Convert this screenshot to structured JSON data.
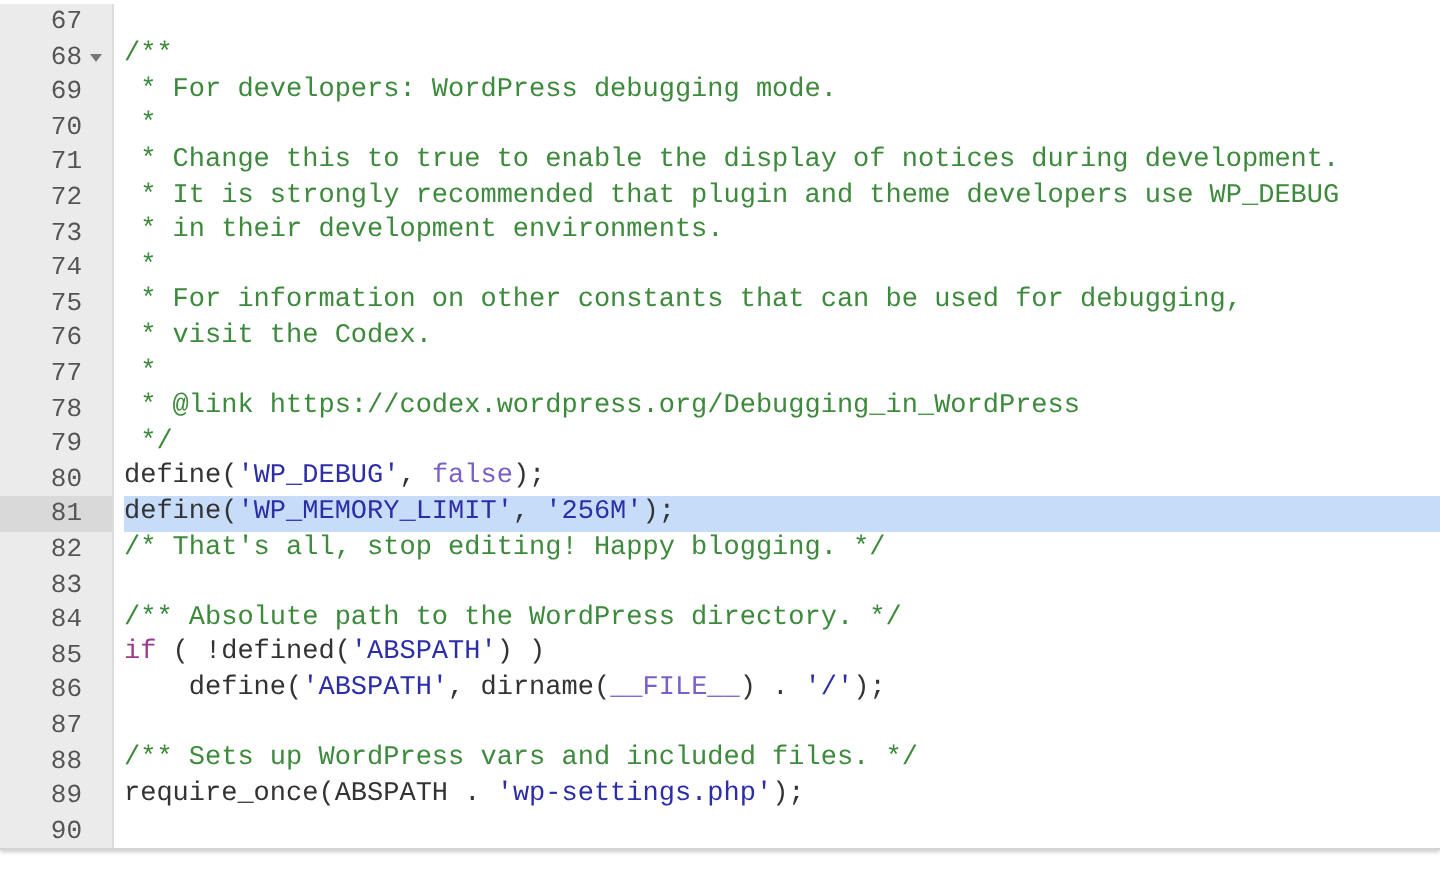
{
  "lines": [
    {
      "number": "67",
      "fold": false,
      "selected": false
    },
    {
      "number": "68",
      "fold": true,
      "selected": false,
      "tokens": [
        {
          "kind": "comment",
          "text": "/**"
        }
      ]
    },
    {
      "number": "69",
      "fold": false,
      "selected": false,
      "tokens": [
        {
          "kind": "comment",
          "text": " * For developers: WordPress debugging mode."
        }
      ]
    },
    {
      "number": "70",
      "fold": false,
      "selected": false,
      "tokens": [
        {
          "kind": "comment",
          "text": " *"
        }
      ]
    },
    {
      "number": "71",
      "fold": false,
      "selected": false,
      "tokens": [
        {
          "kind": "comment",
          "text": " * Change this to true to enable the display of notices during development."
        }
      ]
    },
    {
      "number": "72",
      "fold": false,
      "selected": false,
      "tokens": [
        {
          "kind": "comment",
          "text": " * It is strongly recommended that plugin and theme developers use WP_DEBUG"
        }
      ]
    },
    {
      "number": "73",
      "fold": false,
      "selected": false,
      "tokens": [
        {
          "kind": "comment",
          "text": " * in their development environments."
        }
      ]
    },
    {
      "number": "74",
      "fold": false,
      "selected": false,
      "tokens": [
        {
          "kind": "comment",
          "text": " *"
        }
      ]
    },
    {
      "number": "75",
      "fold": false,
      "selected": false,
      "tokens": [
        {
          "kind": "comment",
          "text": " * For information on other constants that can be used for debugging,"
        }
      ]
    },
    {
      "number": "76",
      "fold": false,
      "selected": false,
      "tokens": [
        {
          "kind": "comment",
          "text": " * visit the Codex."
        }
      ]
    },
    {
      "number": "77",
      "fold": false,
      "selected": false,
      "tokens": [
        {
          "kind": "comment",
          "text": " *"
        }
      ]
    },
    {
      "number": "78",
      "fold": false,
      "selected": false,
      "tokens": [
        {
          "kind": "comment",
          "text": " * @link https://codex.wordpress.org/Debugging_in_WordPress"
        }
      ]
    },
    {
      "number": "79",
      "fold": false,
      "selected": false,
      "tokens": [
        {
          "kind": "comment",
          "text": " */"
        }
      ]
    },
    {
      "number": "80",
      "fold": false,
      "selected": false,
      "tokens": [
        {
          "kind": "plain",
          "text": "define("
        },
        {
          "kind": "string",
          "text": "'WP_DEBUG'"
        },
        {
          "kind": "plain",
          "text": ", "
        },
        {
          "kind": "constant",
          "text": "false"
        },
        {
          "kind": "plain",
          "text": ");"
        }
      ]
    },
    {
      "number": "81",
      "fold": false,
      "selected": true,
      "tokens": [
        {
          "kind": "plain",
          "text": "define("
        },
        {
          "kind": "string",
          "text": "'WP_MEMORY_LIMIT'"
        },
        {
          "kind": "plain",
          "text": ", "
        },
        {
          "kind": "string",
          "text": "'256M'"
        },
        {
          "kind": "plain",
          "text": ");"
        }
      ]
    },
    {
      "number": "82",
      "fold": false,
      "selected": false,
      "tokens": [
        {
          "kind": "comment",
          "text": "/* That's all, stop editing! Happy blogging. */"
        }
      ]
    },
    {
      "number": "83",
      "fold": false,
      "selected": false
    },
    {
      "number": "84",
      "fold": false,
      "selected": false,
      "tokens": [
        {
          "kind": "comment",
          "text": "/** Absolute path to the WordPress directory. */"
        }
      ]
    },
    {
      "number": "85",
      "fold": false,
      "selected": false,
      "tokens": [
        {
          "kind": "keyword",
          "text": "if"
        },
        {
          "kind": "plain",
          "text": " ( !defined("
        },
        {
          "kind": "string",
          "text": "'ABSPATH'"
        },
        {
          "kind": "plain",
          "text": ") )"
        }
      ]
    },
    {
      "number": "86",
      "fold": false,
      "selected": false,
      "tokens": [
        {
          "kind": "plain",
          "text": "    define("
        },
        {
          "kind": "string",
          "text": "'ABSPATH'"
        },
        {
          "kind": "plain",
          "text": ", dirname("
        },
        {
          "kind": "constant",
          "text": "__FILE__"
        },
        {
          "kind": "plain",
          "text": ") . "
        },
        {
          "kind": "string",
          "text": "'/'"
        },
        {
          "kind": "plain",
          "text": ");"
        }
      ]
    },
    {
      "number": "87",
      "fold": false,
      "selected": false
    },
    {
      "number": "88",
      "fold": false,
      "selected": false,
      "tokens": [
        {
          "kind": "comment",
          "text": "/** Sets up WordPress vars and included files. */"
        }
      ]
    },
    {
      "number": "89",
      "fold": false,
      "selected": false,
      "tokens": [
        {
          "kind": "plain",
          "text": "require_once(ABSPATH . "
        },
        {
          "kind": "string",
          "text": "'wp-settings.php'"
        },
        {
          "kind": "plain",
          "text": ");"
        }
      ]
    },
    {
      "number": "90",
      "fold": false,
      "selected": false
    }
  ]
}
